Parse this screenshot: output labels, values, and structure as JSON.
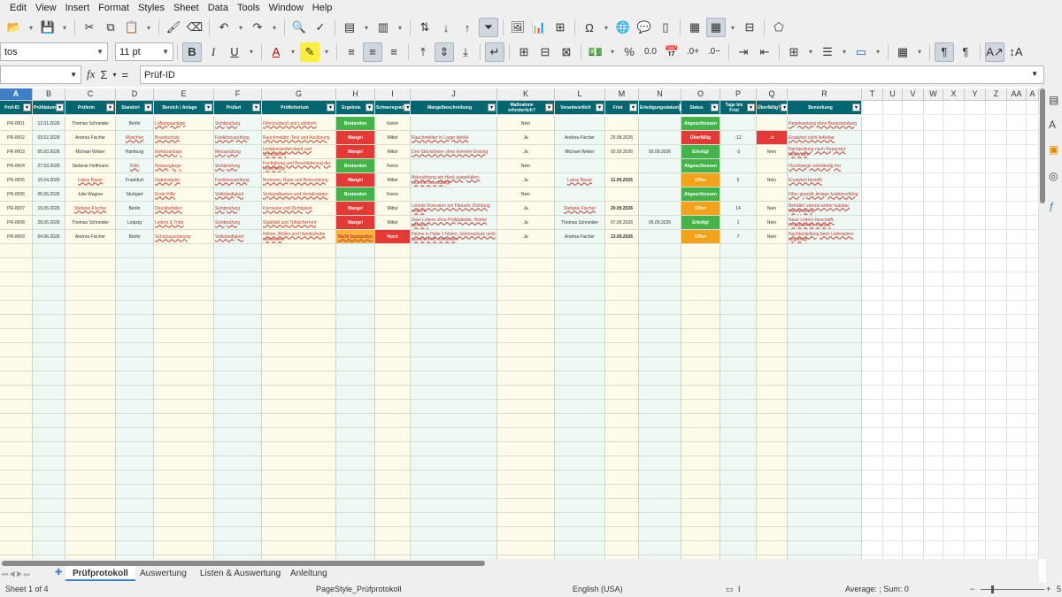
{
  "menu": [
    "Edit",
    "View",
    "Insert",
    "Format",
    "Styles",
    "Sheet",
    "Data",
    "Tools",
    "Window",
    "Help"
  ],
  "toolbar2": {
    "font_name": "tos",
    "font_size": "11 pt"
  },
  "formula_bar": {
    "content": "Prüf-ID"
  },
  "columns": [
    "A",
    "B",
    "C",
    "D",
    "E",
    "F",
    "G",
    "H",
    "I",
    "J",
    "K",
    "L",
    "M",
    "N",
    "O",
    "P",
    "Q",
    "R",
    "T",
    "U",
    "V",
    "W",
    "X",
    "Y",
    "Z",
    "AA",
    "A"
  ],
  "headers": [
    "Prüf-ID",
    "Prüfdatum",
    "Prüferin",
    "Standort",
    "Bereich / Anlage",
    "Prüfart",
    "Prüfkriterium",
    "Ergebnis",
    "Schweregrad",
    "Mangelbeschreibung",
    "Maßnahme erforderlich?",
    "Verantwortlich",
    "Frist",
    "Erledigungsdatum",
    "Status",
    "Tage bis Frist",
    "Überfällig?",
    "Bemerkung"
  ],
  "rows": [
    {
      "id": "PR-0001",
      "datum": "12.01.2026",
      "pruefer": "Thomas Schneider",
      "standort": "Berlin",
      "bereich": "Lüftungsanlage",
      "pruefart": "Sichtprüfung",
      "kriterium": "Filterzustand und Luftstrom",
      "ergebnis": "Bestanden",
      "schwere": "Keine",
      "mangel": "",
      "massnahme": "Nein",
      "verantw": "",
      "frist": "",
      "erledigt": "",
      "status": "Abgeschlossen",
      "tage": "",
      "ueberf": "",
      "bemerk": "Regelwartung ohne Beanstandung"
    },
    {
      "id": "PR-0002",
      "datum": "03.02.2026",
      "pruefer": "Andrea Fischer",
      "standort": "München",
      "bereich": "Brandschutz",
      "pruefart": "Funktionsprüfung",
      "kriterium": "Rauchmelder, Test und Auslösung",
      "ergebnis": "Mangel",
      "schwere": "Mittel",
      "mangel": "Rauchmelder in Lager defekt",
      "massnahme": "Ja",
      "verantw": "Andrea Fischer",
      "frist": "25.08.2026",
      "erledigt": "",
      "status": "Überfällig",
      "tage": "-12",
      "ueberf": "Ja",
      "bemerk": "Ersatzteil nicht lieferbar"
    },
    {
      "id": "PR-0003",
      "datum": "05.03.2026",
      "pruefer": "Michael Weber",
      "standort": "Hamburg",
      "bereich": "Elektroanlage",
      "pruefart": "Messprüfung",
      "kriterium": "Isolationswiderstand und Schutzleiter",
      "ergebnis": "Mangel",
      "schwere": "Mittel",
      "mangel": "Drei Steckdosen ohne korrekte Erdung",
      "massnahme": "Ja",
      "verantw": "Michael Weber",
      "frist": "02.09.2026",
      "erledigt": "05.09.2026",
      "status": "Erledigt",
      "tage": "-3",
      "ueberf": "Nein",
      "bemerk": "Nachprüfung nach Reparatur bestanden"
    },
    {
      "id": "PR-0004",
      "datum": "27.03.2026",
      "pruefer": "Stefanie Hoffmann",
      "standort": "Köln",
      "bereich": "Notausgänge",
      "pruefart": "Sichtprüfung",
      "kriterium": "Freihaltung und Beschilderung der Fluchtwege",
      "ergebnis": "Bestanden",
      "schwere": "Keine",
      "mangel": "",
      "massnahme": "Nein",
      "verantw": "",
      "frist": "",
      "erledigt": "",
      "status": "Abgeschlossen",
      "tage": "",
      "ueberf": "",
      "bemerk": "Fluchtwege vollständig frei"
    },
    {
      "id": "PR-0005",
      "datum": "15.04.2026",
      "pruefer": "Lukas Bauer",
      "standort": "Frankfurt",
      "bereich": "Gabelstapler",
      "pruefart": "Funktionsprüfung",
      "kriterium": "Bremsen, Hupe und Beleuchtung",
      "ergebnis": "Mangel",
      "schwere": "Mittel",
      "mangel": "Beleuchtung am Heck ausgefallen, Leuchte beschädigt",
      "massnahme": "Ja",
      "verantw": "Lukas Bauer",
      "frist": "11.09.2026",
      "erledigt": "",
      "status": "Offen",
      "tage": "5",
      "ueberf": "Nein",
      "bemerk": "Ersatzteil bestellt"
    },
    {
      "id": "PR-0006",
      "datum": "05.05.2026",
      "pruefer": "Julia Wagner",
      "standort": "Stuttgart",
      "bereich": "Erste Hilfe",
      "pruefart": "Vollständigkeit",
      "kriterium": "Verbandkasten und Verfallsdaten",
      "ergebnis": "Bestanden",
      "schwere": "Keine",
      "mangel": "",
      "massnahme": "Nein",
      "verantw": "",
      "frist": "",
      "erledigt": "",
      "status": "Abgeschlossen",
      "tage": "",
      "ueberf": "",
      "bemerk": "Filter geprüft, Anlage funktionsfähig"
    },
    {
      "id": "PR-0007",
      "datum": "19.05.2026",
      "pruefer": "Stefanie Fischer",
      "standort": "Berlin",
      "bereich": "Druckbehälter",
      "pruefart": "Sichtprüfung",
      "kriterium": "Korrosion und Dichtigkeit",
      "ergebnis": "Mangel",
      "schwere": "Mittel",
      "mangel": "Leichte Korrosion am Flansch, Dichtung undicht",
      "massnahme": "Ja",
      "verantw": "Stefanie Fischer",
      "frist": "20.09.2026",
      "erledigt": "",
      "status": "Offen",
      "tage": "14",
      "ueberf": "Nein",
      "bemerk": "Behälter vorerst weiter nutzbar, Nachprüfung"
    },
    {
      "id": "PR-0008",
      "datum": "28.05.2026",
      "pruefer": "Thomas Schneider",
      "standort": "Leipzig",
      "bereich": "Leitern & Tritte",
      "pruefart": "Sichtprüfung",
      "kriterium": "Stabilität und Trittsicherheit",
      "ergebnis": "Mangel",
      "schwere": "Mittel",
      "mangel": "Zwei Leitern ohne Prüfplakette, Holme gerissen",
      "massnahme": "Ja",
      "verantw": "Thomas Schneider",
      "frist": "07.09.2026",
      "erledigt": "05.09.2026",
      "status": "Erledigt",
      "tage": "1",
      "ueberf": "Nein",
      "bemerk": "Neue Leitern beschafft, Prüfplaketten ergänzt"
    },
    {
      "id": "PR-0009",
      "datum": "04.06.2026",
      "pruefer": "Andrea Fischer",
      "standort": "Berlin",
      "bereich": "Schutzausrüstung",
      "pruefart": "Vollständigkeit",
      "kriterium": "Helme, Brillen und Handschuhe vorhanden",
      "ergebnis": "Nicht bestanden",
      "schwere": "Hoch",
      "mangel": "Helme in Halle 2 fehlen, Gehörschutz nicht ausreichend vorhanden",
      "massnahme": "Ja",
      "verantw": "Andrea Fischer",
      "frist": "13.09.2026",
      "erledigt": "",
      "status": "Offen",
      "tage": "7",
      "ueberf": "Nein",
      "bemerk": "Nachbestellung beim Lieferanten angefragt"
    }
  ],
  "sheet_tabs": [
    "Prüfprotokoll",
    "Auswertung",
    "Listen & Auswertung",
    "Anleitung"
  ],
  "status_bar": {
    "sheet": "Sheet 1 of 4",
    "page_style": "PageStyle_Prüfprotokoll",
    "language": "English (USA)",
    "summary": "Average: ; Sum: 0",
    "zoom": "5"
  },
  "colors": {
    "header_teal": "#00666f",
    "status_red": "#e53935",
    "status_green": "#43b34a",
    "status_orange": "#f4a11c",
    "selected_col": "#3d7ec9"
  }
}
